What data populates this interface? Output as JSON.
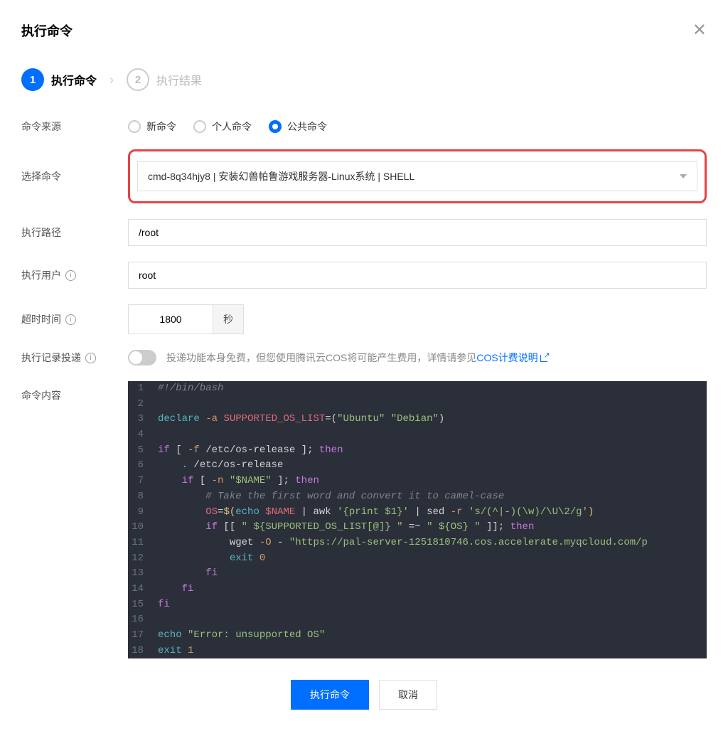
{
  "header": {
    "title": "执行命令"
  },
  "steps": {
    "step1_label": "执行命令",
    "step2_label": "执行结果",
    "step1_num": "1",
    "step2_num": "2"
  },
  "labels": {
    "source": "命令来源",
    "select_command": "选择命令",
    "exec_path": "执行路径",
    "exec_user": "执行用户",
    "timeout": "超时时间",
    "log_delivery": "执行记录投递",
    "command_content": "命令内容"
  },
  "source_options": {
    "new": "新命令",
    "personal": "个人命令",
    "public": "公共命令"
  },
  "select_command_value": "cmd-8q34hjy8 | 安装幻兽帕鲁游戏服务器-Linux系统 | SHELL",
  "exec_path_value": "/root",
  "exec_user_value": "root",
  "timeout_value": "1800",
  "timeout_unit": "秒",
  "log_delivery_text": "投递功能本身免费，但您使用腾讯云COS将可能产生费用，详情请参见",
  "log_delivery_link_text": "COS计费说明",
  "code_lines": [
    {
      "n": "1",
      "raw": "#!/bin/bash",
      "cls": "c-comment"
    },
    {
      "n": "2",
      "raw": ""
    },
    {
      "n": "3",
      "html": "<span class='c-builtin'>declare</span> <span class='c-flag'>-a</span> <span class='c-var'>SUPPORTED_OS_LIST</span>=(<span class='c-string'>\"Ubuntu\"</span> <span class='c-string'>\"Debian\"</span>)"
    },
    {
      "n": "4",
      "raw": ""
    },
    {
      "n": "5",
      "html": "<span class='c-keyword'>if</span> [ <span class='c-flag'>-f</span> /etc/os-release ]; <span class='c-keyword'>then</span>"
    },
    {
      "n": "6",
      "html": "    <span class='c-builtin'>.</span> /etc/os-release"
    },
    {
      "n": "7",
      "html": "    <span class='c-keyword'>if</span> [ <span class='c-flag'>-n</span> <span class='c-string'>\"$NAME\"</span> ]; <span class='c-keyword'>then</span>"
    },
    {
      "n": "8",
      "html": "        <span class='c-comment'># Take the first word and convert it to camel-case</span>"
    },
    {
      "n": "9",
      "html": "        <span class='c-var'>OS</span>=<span class='c-op'>$(</span><span class='c-builtin'>echo</span> <span class='c-var'>$NAME</span> | awk <span class='c-string'>'{print $1}'</span> | sed <span class='c-flag'>-r</span> <span class='c-string'>'s/(^|-)(\\w)/\\U\\2/g'</span><span class='c-op'>)</span>"
    },
    {
      "n": "10",
      "html": "        <span class='c-keyword'>if</span> [[ <span class='c-string'>\" ${SUPPORTED_OS_LIST[@]} \"</span> =~ <span class='c-string'>\" ${OS} \"</span> ]]; <span class='c-keyword'>then</span>"
    },
    {
      "n": "11",
      "html": "            wget <span class='c-flag'>-O</span> - <span class='c-string'>\"https://pal-server-1251810746.cos.accelerate.myqcloud.com/p</span>"
    },
    {
      "n": "12",
      "html": "            <span class='c-builtin'>exit</span> <span class='c-flag'>0</span>"
    },
    {
      "n": "13",
      "html": "        <span class='c-keyword'>fi</span>"
    },
    {
      "n": "14",
      "html": "    <span class='c-keyword'>fi</span>"
    },
    {
      "n": "15",
      "html": "<span class='c-keyword'>fi</span>"
    },
    {
      "n": "16",
      "raw": ""
    },
    {
      "n": "17",
      "html": "<span class='c-builtin'>echo</span> <span class='c-string'>\"Error: unsupported OS\"</span>"
    },
    {
      "n": "18",
      "html": "<span class='c-builtin'>exit</span> <span class='c-flag'>1</span>"
    }
  ],
  "footer": {
    "execute": "执行命令",
    "cancel": "取消"
  }
}
